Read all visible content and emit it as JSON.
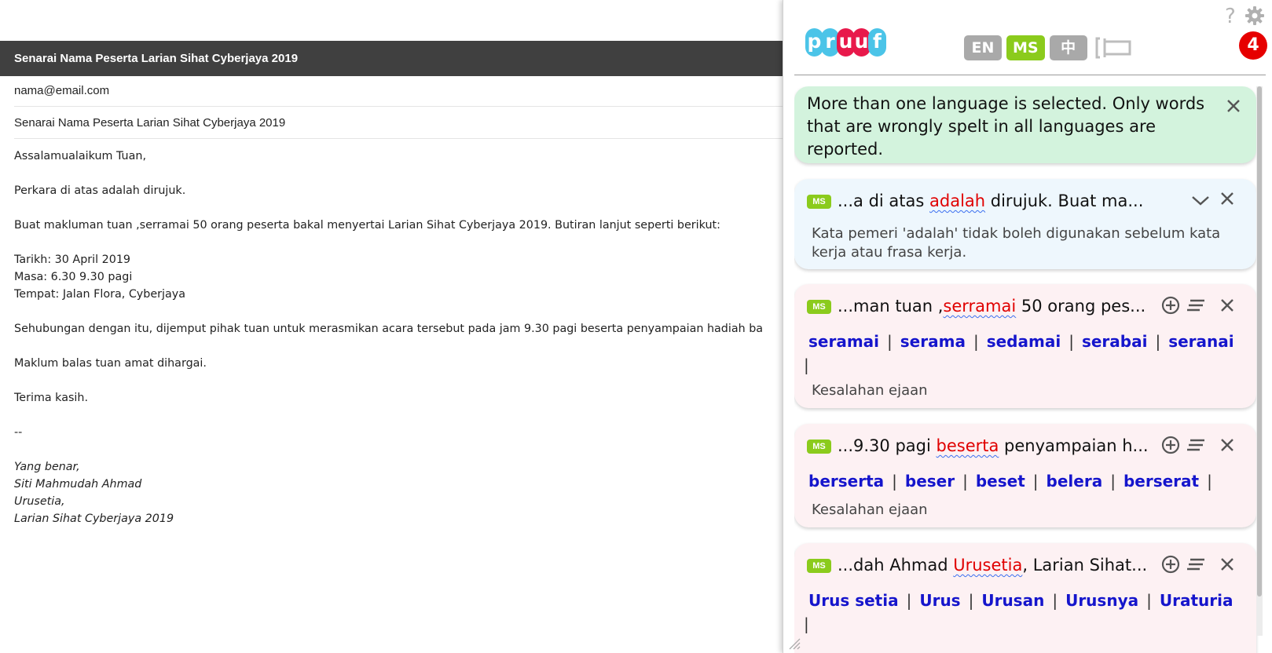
{
  "email": {
    "header_title": "Senarai Nama Peserta Larian Sihat Cyberjaya 2019",
    "to": "nama@email.com",
    "subject": "Senarai Nama Peserta Larian Sihat Cyberjaya 2019",
    "body": {
      "greeting": "Assalamualaikum Tuan,",
      "line1": "Perkara di atas adalah dirujuk.",
      "line2": "Buat makluman tuan ,serramai 50 orang peserta bakal menyertai Larian Sihat Cyberjaya 2019. Butiran lanjut seperti berikut:",
      "date": "Tarikh: 30 April 2019",
      "time": "Masa: 6.30 9.30 pagi",
      "place": "Tempat: Jalan Flora, Cyberjaya",
      "line3": "Sehubungan dengan itu, dijemput pihak tuan untuk merasmikan acara tersebut pada jam 9.30 pagi beserta penyampaian hadiah ba",
      "line4": "Maklum balas tuan amat dihargai.",
      "thanks": "Terima kasih.",
      "dashes": "--",
      "sig1": "Yang benar,",
      "sig2": "Siti Mahmudah Ahmad",
      "sig3": "Urusetia,",
      "sig4": "Larian Sihat Cyberjaya 2019"
    }
  },
  "pruuf": {
    "logo_letters": [
      "p",
      "r",
      "u",
      "u",
      "f"
    ],
    "logo_colors": [
      "#4bc4e8",
      "#4bc4e8",
      "#e8194b",
      "#e8194b",
      "#4bc4e8"
    ],
    "languages": [
      {
        "label": "EN",
        "active": false
      },
      {
        "label": "MS",
        "active": true
      },
      {
        "label": "中",
        "active": false
      }
    ],
    "help_label": "?",
    "error_count": "4",
    "info_message": "More than one language is selected. Only words that are wrongly spelt in all languages are reported.",
    "cards": [
      {
        "lang": "MS",
        "before": "...a di atas ",
        "error": "adalah",
        "after": " dirujuk. Buat ma...",
        "description": "Kata pemeri 'adalah' tidak boleh digunakan sebelum kata kerja atau frasa kerja."
      },
      {
        "lang": "MS",
        "before": "...man tuan ,",
        "error": "serramai",
        "after": " 50 orang pes...",
        "suggestions": [
          "seramai",
          "serama",
          "sedamai",
          "serabai",
          "seranai"
        ],
        "description": "Kesalahan ejaan"
      },
      {
        "lang": "MS",
        "before": "...9.30 pagi ",
        "error": "beserta",
        "after": " penyampaian h...",
        "suggestions": [
          "berserta",
          "beser",
          "beset",
          "belera",
          "berserat"
        ],
        "description": "Kesalahan ejaan"
      },
      {
        "lang": "MS",
        "before": "...dah Ahmad ",
        "error": "Urusetia",
        "after": ", Larian Sihat...",
        "suggestions": [
          "Urus setia",
          "Urus",
          "Urusan",
          "Urusnya",
          "Uraturia"
        ]
      }
    ],
    "colors": {
      "accent_green": "#8bcb1c",
      "error_red": "#e00000",
      "suggestion_blue": "#1515cc",
      "badge_red": "#e60000"
    }
  }
}
